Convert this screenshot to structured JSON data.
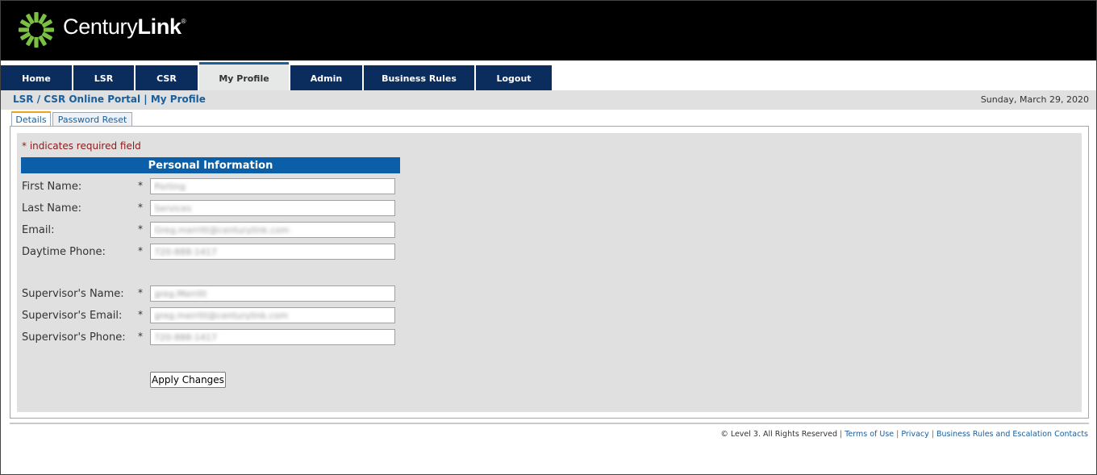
{
  "brand": {
    "name_light": "Century",
    "name_bold": "Link",
    "registered": "®"
  },
  "nav": {
    "items": [
      {
        "label": "Home"
      },
      {
        "label": "LSR"
      },
      {
        "label": "CSR"
      },
      {
        "label": "My Profile",
        "active": true
      },
      {
        "label": "Admin"
      },
      {
        "label": "Business Rules"
      },
      {
        "label": "Logout"
      }
    ]
  },
  "breadcrumb": "LSR / CSR Online Portal | My Profile",
  "date": "Sunday, March 29, 2020",
  "tabs": [
    {
      "label": "Details",
      "active": true
    },
    {
      "label": "Password Reset"
    }
  ],
  "form": {
    "required_note": "* indicates required field",
    "section_title": "Personal Information",
    "required_marker": "*",
    "fields": {
      "first_name": {
        "label": "First Name:",
        "value": "Porting"
      },
      "last_name": {
        "label": "Last Name:",
        "value": "Services"
      },
      "email": {
        "label": "Email:",
        "value": "Greg.merritt@centurylink.com"
      },
      "daytime_phone": {
        "label": "Daytime Phone:",
        "value": "720-888-1417"
      },
      "supervisor_name": {
        "label": "Supervisor's Name:",
        "value": "greg.Merritt"
      },
      "supervisor_email": {
        "label": "Supervisor's Email:",
        "value": "greg.merritt@centurylink.com"
      },
      "supervisor_phone": {
        "label": "Supervisor's Phone:",
        "value": "720-888-1417"
      }
    },
    "apply_label": "Apply Changes"
  },
  "footer": {
    "copyright": "© Level 3. All Rights Reserved",
    "separator": "|",
    "links": [
      "Terms of Use",
      "Privacy",
      "Business Rules and Escalation Contacts"
    ]
  },
  "colors": {
    "nav_bg": "#0b2d5e",
    "section_header": "#0b5ea8",
    "link": "#1a5e9a",
    "required_note": "#8b1a1a",
    "logo_green": "#7ac143"
  }
}
